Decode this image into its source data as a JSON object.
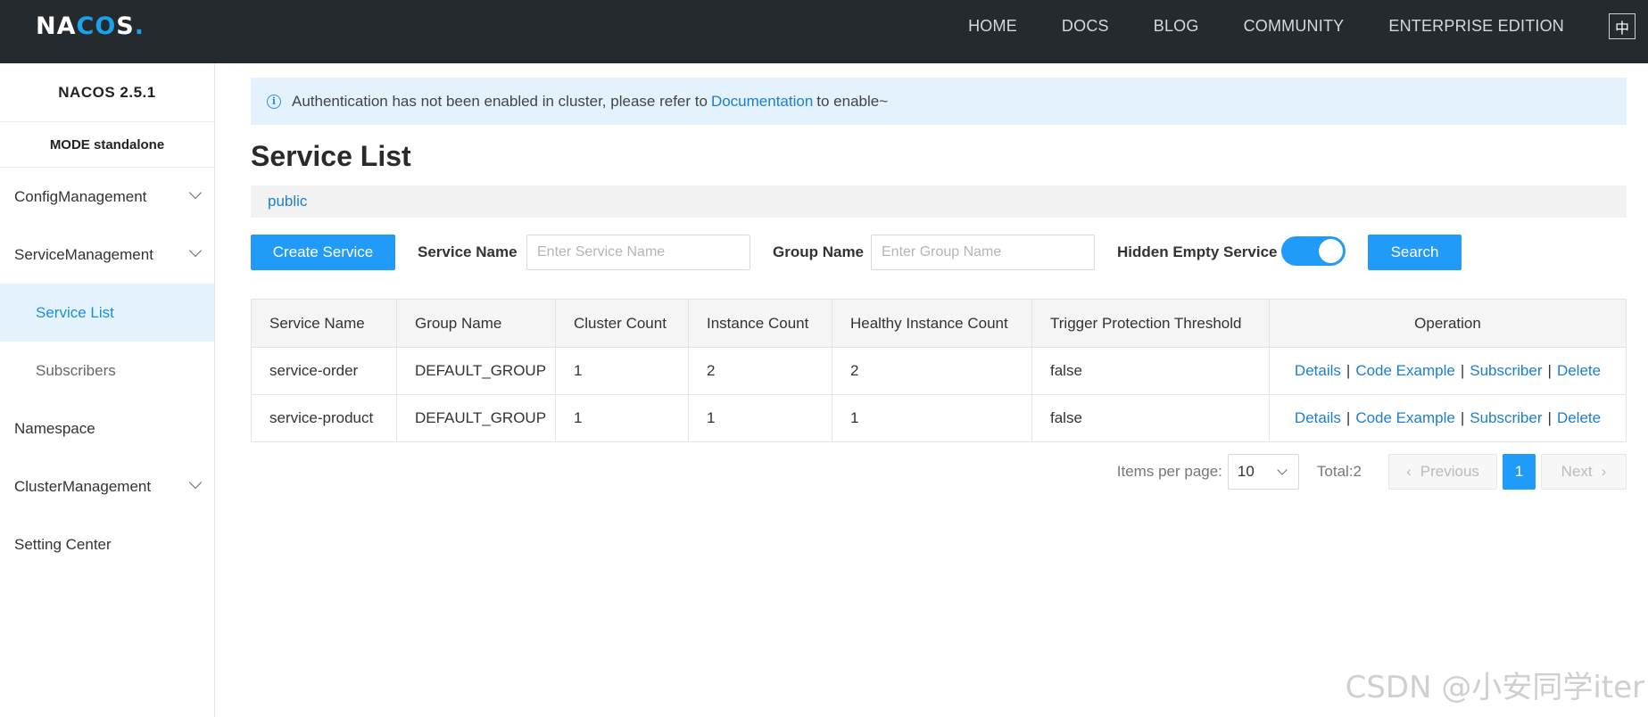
{
  "topbar": {
    "logo": {
      "part1": "NA",
      "part2": "CO",
      "part3": "S",
      "dot": "."
    },
    "nav": [
      "HOME",
      "DOCS",
      "BLOG",
      "COMMUNITY",
      "ENTERPRISE EDITION"
    ],
    "lang_button": "中"
  },
  "sidebar": {
    "version": "NACOS 2.5.1",
    "mode": "MODE standalone",
    "items": [
      {
        "label": "ConfigManagement",
        "expandable": true
      },
      {
        "label": "ServiceManagement",
        "expandable": true
      },
      {
        "label": "Service List",
        "sub": true,
        "active": true
      },
      {
        "label": "Subscribers",
        "sub": true
      },
      {
        "label": "Namespace"
      },
      {
        "label": "ClusterManagement",
        "expandable": true
      },
      {
        "label": "Setting Center"
      }
    ]
  },
  "notice": {
    "before": "Authentication has not been enabled in cluster, please refer to",
    "link": "Documentation",
    "after": "to enable~"
  },
  "page_title": "Service List",
  "namespace": "public",
  "toolbar": {
    "create_button": "Create Service",
    "service_name_label": "Service Name",
    "service_name_placeholder": "Enter Service Name",
    "group_name_label": "Group Name",
    "group_name_placeholder": "Enter Group Name",
    "hidden_empty_label": "Hidden Empty Service",
    "hidden_empty_on": true,
    "search_button": "Search"
  },
  "table": {
    "headers": [
      "Service Name",
      "Group Name",
      "Cluster Count",
      "Instance Count",
      "Healthy Instance Count",
      "Trigger Protection Threshold",
      "Operation"
    ],
    "rows": [
      [
        "service-order",
        "DEFAULT_GROUP",
        "1",
        "2",
        "2",
        "false"
      ],
      [
        "service-product",
        "DEFAULT_GROUP",
        "1",
        "1",
        "1",
        "false"
      ]
    ],
    "operations": [
      "Details",
      "Code Example",
      "Subscriber",
      "Delete"
    ]
  },
  "pagination": {
    "items_per_page_label": "Items per page:",
    "items_per_page": "10",
    "total": "Total:2",
    "previous": "Previous",
    "current_page": "1",
    "next": "Next"
  },
  "watermark": "CSDN @小安同学iter",
  "colors": {
    "primary": "#209bfa",
    "topbar": "#252a2f",
    "link": "#1b7ed0",
    "notice_bg": "#e3f2fd"
  }
}
